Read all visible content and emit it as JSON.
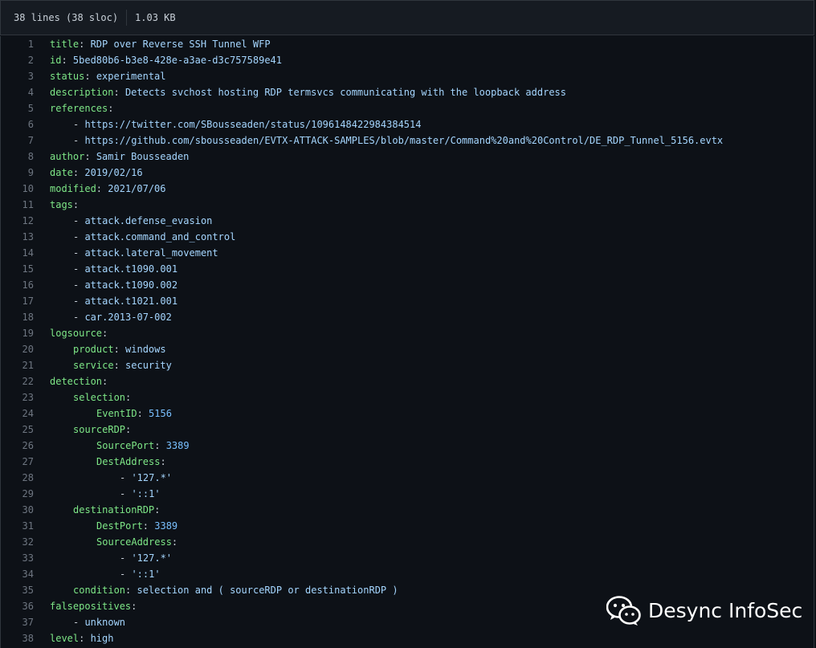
{
  "header": {
    "lines_info": "38 lines (38 sloc)",
    "size": "1.03 KB"
  },
  "code_lines": [
    {
      "n": "1",
      "indent": 0,
      "tokens": [
        [
          "k",
          "title"
        ],
        [
          "p",
          ": "
        ],
        [
          "s",
          "RDP over Reverse SSH Tunnel WFP"
        ]
      ]
    },
    {
      "n": "2",
      "indent": 0,
      "tokens": [
        [
          "k",
          "id"
        ],
        [
          "p",
          ": "
        ],
        [
          "s",
          "5bed80b6-b3e8-428e-a3ae-d3c757589e41"
        ]
      ]
    },
    {
      "n": "3",
      "indent": 0,
      "tokens": [
        [
          "k",
          "status"
        ],
        [
          "p",
          ": "
        ],
        [
          "s",
          "experimental"
        ]
      ]
    },
    {
      "n": "4",
      "indent": 0,
      "tokens": [
        [
          "k",
          "description"
        ],
        [
          "p",
          ": "
        ],
        [
          "s",
          "Detects svchost hosting RDP termsvcs communicating with the loopback address"
        ]
      ]
    },
    {
      "n": "5",
      "indent": 0,
      "tokens": [
        [
          "k",
          "references"
        ],
        [
          "p",
          ":"
        ]
      ]
    },
    {
      "n": "6",
      "indent": 1,
      "tokens": [
        [
          "p",
          "- "
        ],
        [
          "s",
          "https://twitter.com/SBousseaden/status/1096148422984384514"
        ]
      ]
    },
    {
      "n": "7",
      "indent": 1,
      "tokens": [
        [
          "p",
          "- "
        ],
        [
          "s",
          "https://github.com/sbousseaden/EVTX-ATTACK-SAMPLES/blob/master/Command%20and%20Control/DE_RDP_Tunnel_5156.evtx"
        ]
      ]
    },
    {
      "n": "8",
      "indent": 0,
      "tokens": [
        [
          "k",
          "author"
        ],
        [
          "p",
          ": "
        ],
        [
          "s",
          "Samir Bousseaden"
        ]
      ]
    },
    {
      "n": "9",
      "indent": 0,
      "tokens": [
        [
          "k",
          "date"
        ],
        [
          "p",
          ": "
        ],
        [
          "s",
          "2019/02/16"
        ]
      ]
    },
    {
      "n": "10",
      "indent": 0,
      "tokens": [
        [
          "k",
          "modified"
        ],
        [
          "p",
          ": "
        ],
        [
          "s",
          "2021/07/06"
        ]
      ]
    },
    {
      "n": "11",
      "indent": 0,
      "tokens": [
        [
          "k",
          "tags"
        ],
        [
          "p",
          ":"
        ]
      ]
    },
    {
      "n": "12",
      "indent": 1,
      "tokens": [
        [
          "p",
          "- "
        ],
        [
          "s",
          "attack.defense_evasion"
        ]
      ]
    },
    {
      "n": "13",
      "indent": 1,
      "tokens": [
        [
          "p",
          "- "
        ],
        [
          "s",
          "attack.command_and_control"
        ]
      ]
    },
    {
      "n": "14",
      "indent": 1,
      "tokens": [
        [
          "p",
          "- "
        ],
        [
          "s",
          "attack.lateral_movement"
        ]
      ]
    },
    {
      "n": "15",
      "indent": 1,
      "tokens": [
        [
          "p",
          "- "
        ],
        [
          "s",
          "attack.t1090.001"
        ]
      ]
    },
    {
      "n": "16",
      "indent": 1,
      "tokens": [
        [
          "p",
          "- "
        ],
        [
          "s",
          "attack.t1090.002"
        ]
      ]
    },
    {
      "n": "17",
      "indent": 1,
      "tokens": [
        [
          "p",
          "- "
        ],
        [
          "s",
          "attack.t1021.001"
        ]
      ]
    },
    {
      "n": "18",
      "indent": 1,
      "tokens": [
        [
          "p",
          "- "
        ],
        [
          "s",
          "car.2013-07-002"
        ]
      ]
    },
    {
      "n": "19",
      "indent": 0,
      "tokens": [
        [
          "k",
          "logsource"
        ],
        [
          "p",
          ":"
        ]
      ]
    },
    {
      "n": "20",
      "indent": 1,
      "tokens": [
        [
          "k",
          "product"
        ],
        [
          "p",
          ": "
        ],
        [
          "s",
          "windows"
        ]
      ]
    },
    {
      "n": "21",
      "indent": 1,
      "tokens": [
        [
          "k",
          "service"
        ],
        [
          "p",
          ": "
        ],
        [
          "s",
          "security"
        ]
      ]
    },
    {
      "n": "22",
      "indent": 0,
      "tokens": [
        [
          "k",
          "detection"
        ],
        [
          "p",
          ":"
        ]
      ]
    },
    {
      "n": "23",
      "indent": 1,
      "tokens": [
        [
          "k",
          "selection"
        ],
        [
          "p",
          ":"
        ]
      ]
    },
    {
      "n": "24",
      "indent": 2,
      "tokens": [
        [
          "k",
          "EventID"
        ],
        [
          "p",
          ": "
        ],
        [
          "n",
          "5156"
        ]
      ]
    },
    {
      "n": "25",
      "indent": 1,
      "tokens": [
        [
          "k",
          "sourceRDP"
        ],
        [
          "p",
          ":"
        ]
      ]
    },
    {
      "n": "26",
      "indent": 2,
      "tokens": [
        [
          "k",
          "SourcePort"
        ],
        [
          "p",
          ": "
        ],
        [
          "n",
          "3389"
        ]
      ]
    },
    {
      "n": "27",
      "indent": 2,
      "tokens": [
        [
          "k",
          "DestAddress"
        ],
        [
          "p",
          ":"
        ]
      ]
    },
    {
      "n": "28",
      "indent": 3,
      "tokens": [
        [
          "p",
          "- "
        ],
        [
          "s",
          "'127.*'"
        ]
      ]
    },
    {
      "n": "29",
      "indent": 3,
      "tokens": [
        [
          "p",
          "- "
        ],
        [
          "s",
          "'::1'"
        ]
      ]
    },
    {
      "n": "30",
      "indent": 1,
      "tokens": [
        [
          "k",
          "destinationRDP"
        ],
        [
          "p",
          ":"
        ]
      ]
    },
    {
      "n": "31",
      "indent": 2,
      "tokens": [
        [
          "k",
          "DestPort"
        ],
        [
          "p",
          ": "
        ],
        [
          "n",
          "3389"
        ]
      ]
    },
    {
      "n": "32",
      "indent": 2,
      "tokens": [
        [
          "k",
          "SourceAddress"
        ],
        [
          "p",
          ":"
        ]
      ]
    },
    {
      "n": "33",
      "indent": 3,
      "tokens": [
        [
          "p",
          "- "
        ],
        [
          "s",
          "'127.*'"
        ]
      ]
    },
    {
      "n": "34",
      "indent": 3,
      "tokens": [
        [
          "p",
          "- "
        ],
        [
          "s",
          "'::1'"
        ]
      ]
    },
    {
      "n": "35",
      "indent": 1,
      "tokens": [
        [
          "k",
          "condition"
        ],
        [
          "p",
          ": "
        ],
        [
          "s",
          "selection and ( sourceRDP or destinationRDP )"
        ]
      ]
    },
    {
      "n": "36",
      "indent": 0,
      "tokens": [
        [
          "k",
          "falsepositives"
        ],
        [
          "p",
          ":"
        ]
      ]
    },
    {
      "n": "37",
      "indent": 1,
      "tokens": [
        [
          "p",
          "- "
        ],
        [
          "s",
          "unknown"
        ]
      ]
    },
    {
      "n": "38",
      "indent": 0,
      "tokens": [
        [
          "k",
          "level"
        ],
        [
          "p",
          ": "
        ],
        [
          "s",
          "high"
        ]
      ]
    }
  ],
  "watermark": {
    "icon": "wechat-icon",
    "text": "Desync InfoSec"
  },
  "colors": {
    "background": "#0d1117",
    "key": "#7ee787",
    "string": "#a5d6ff",
    "number": "#79c0ff",
    "line_number": "#6e7681"
  }
}
